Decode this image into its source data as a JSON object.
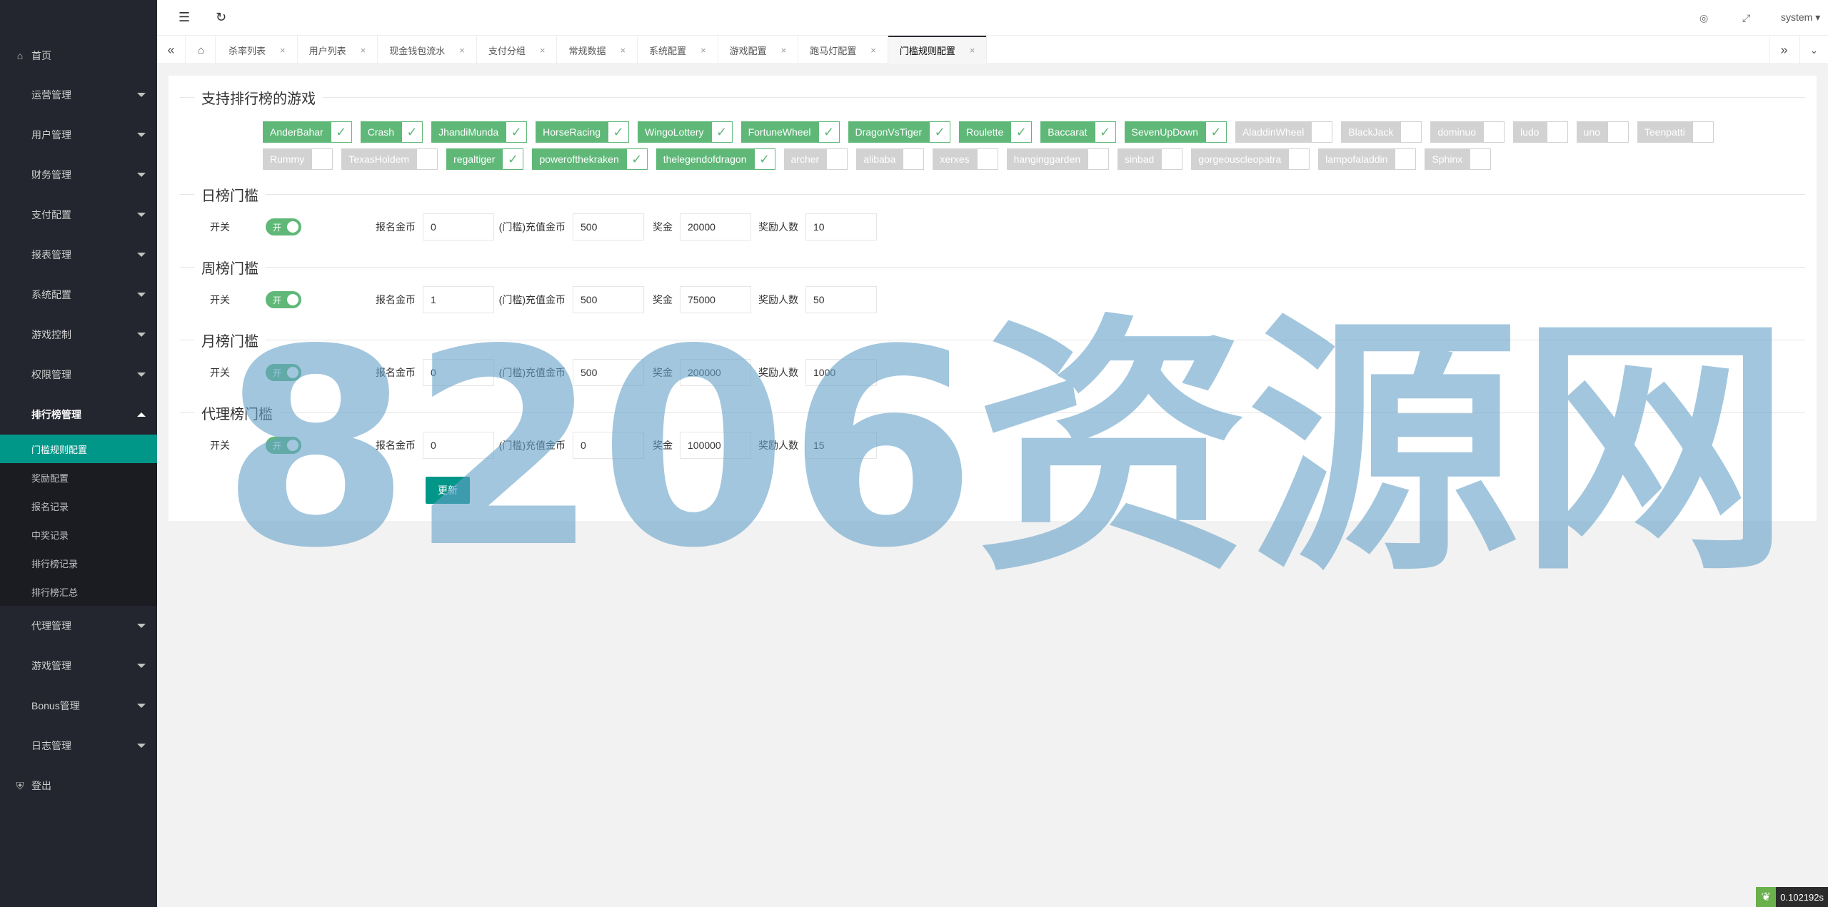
{
  "sidebar": {
    "home": "首页",
    "items": [
      {
        "label": "运营管理"
      },
      {
        "label": "用户管理"
      },
      {
        "label": "财务管理"
      },
      {
        "label": "支付配置"
      },
      {
        "label": "报表管理"
      },
      {
        "label": "系统配置"
      },
      {
        "label": "游戏控制"
      },
      {
        "label": "权限管理"
      }
    ],
    "open_group": "排行榜管理",
    "sub_items": [
      {
        "label": "门槛规则配置",
        "active": true
      },
      {
        "label": "奖励配置"
      },
      {
        "label": "报名记录"
      },
      {
        "label": "中奖记录"
      },
      {
        "label": "排行榜记录"
      },
      {
        "label": "排行榜汇总"
      }
    ],
    "items_after": [
      {
        "label": "代理管理"
      },
      {
        "label": "游戏管理"
      },
      {
        "label": "Bonus管理"
      },
      {
        "label": "日志管理"
      }
    ],
    "logout": "登出"
  },
  "header": {
    "user": "system"
  },
  "tabs": [
    {
      "label": "杀率列表"
    },
    {
      "label": "用户列表"
    },
    {
      "label": "现金钱包流水"
    },
    {
      "label": "支付分组"
    },
    {
      "label": "常规数据"
    },
    {
      "label": "系统配置"
    },
    {
      "label": "游戏配置"
    },
    {
      "label": "跑马灯配置"
    },
    {
      "label": "门槛规则配置",
      "active": true
    }
  ],
  "form": {
    "games_legend": "支持排行榜的游戏",
    "games_row1": [
      {
        "name": "AnderBahar",
        "checked": true
      },
      {
        "name": "Crash",
        "checked": true
      },
      {
        "name": "JhandiMunda",
        "checked": true
      },
      {
        "name": "HorseRacing",
        "checked": true
      },
      {
        "name": "WingoLottery",
        "checked": true
      },
      {
        "name": "FortuneWheel",
        "checked": true
      },
      {
        "name": "DragonVsTiger",
        "checked": true
      },
      {
        "name": "Roulette",
        "checked": true
      },
      {
        "name": "Baccarat",
        "checked": true
      },
      {
        "name": "SevenUpDown",
        "checked": true
      },
      {
        "name": "AladdinWheel",
        "checked": false
      },
      {
        "name": "BlackJack",
        "checked": false
      },
      {
        "name": "dominuo",
        "checked": false
      },
      {
        "name": "ludo",
        "checked": false
      },
      {
        "name": "uno",
        "checked": false
      },
      {
        "name": "Teenpatti",
        "checked": false
      }
    ],
    "games_row2": [
      {
        "name": "Rummy",
        "checked": false
      },
      {
        "name": "TexasHoldem",
        "checked": false
      },
      {
        "name": "regaltiger",
        "checked": true
      },
      {
        "name": "powerofthekraken",
        "checked": true
      },
      {
        "name": "thelegendofdragon",
        "checked": true
      },
      {
        "name": "archer",
        "checked": false
      },
      {
        "name": "alibaba",
        "checked": false
      },
      {
        "name": "xerxes",
        "checked": false
      },
      {
        "name": "hanginggarden",
        "checked": false
      },
      {
        "name": "sinbad",
        "checked": false
      },
      {
        "name": "gorgeouscleopatra",
        "checked": false
      },
      {
        "name": "lampofaladdin",
        "checked": false
      },
      {
        "name": "Sphinx",
        "checked": false
      }
    ],
    "labels": {
      "switch": "开关",
      "on_text": "开",
      "signup_coins": "报名金币",
      "threshold_recharge": "(门槛)充值金币",
      "prize": "奖金",
      "winners": "奖励人数"
    },
    "sections": [
      {
        "title": "日榜门槛",
        "on": true,
        "signup": "0",
        "recharge": "500",
        "prize": "20000",
        "winners": "10"
      },
      {
        "title": "周榜门槛",
        "on": true,
        "signup": "1",
        "recharge": "500",
        "prize": "75000",
        "winners": "50"
      },
      {
        "title": "月榜门槛",
        "on": true,
        "signup": "0",
        "recharge": "500",
        "prize": "200000",
        "winners": "1000"
      },
      {
        "title": "代理榜门槛",
        "on": true,
        "signup": "0",
        "recharge": "0",
        "prize": "100000",
        "winners": "15"
      }
    ],
    "update_button": "更新"
  },
  "watermark": "8206资源网",
  "timer": "0.102192s",
  "colors": {
    "accent": "#009688",
    "green": "#5fb878",
    "sidebar": "#23262e"
  }
}
